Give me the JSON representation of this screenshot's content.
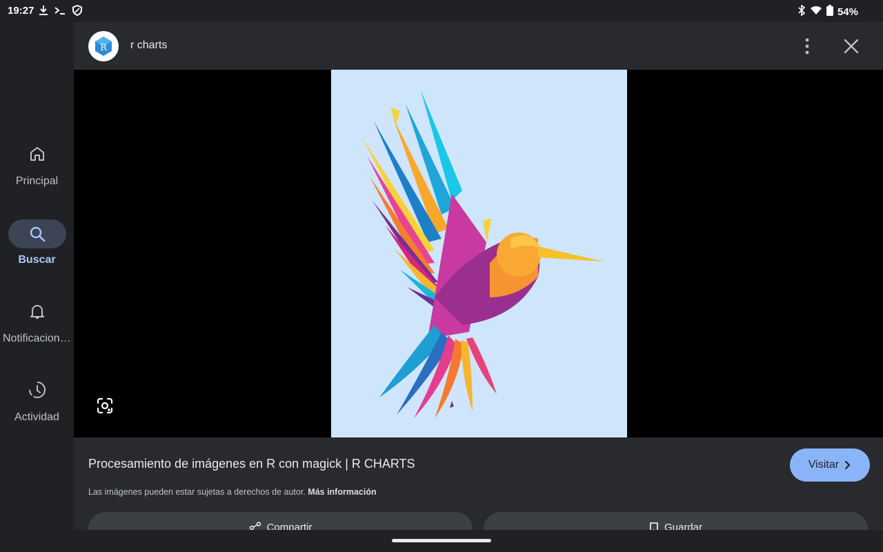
{
  "status_bar": {
    "time": "19:27",
    "battery_percent": "54%",
    "left_icons": [
      "download-icon",
      "terminal-icon",
      "shield-icon"
    ],
    "right_icons": [
      "bluetooth-icon",
      "wifi-icon",
      "battery-icon"
    ]
  },
  "rail": {
    "items": [
      {
        "label": "Principal",
        "icon": "home-icon",
        "active": false
      },
      {
        "label": "Buscar",
        "icon": "search-icon",
        "active": true
      },
      {
        "label": "Notificaciones",
        "icon": "bell-icon",
        "active": false
      },
      {
        "label": "Actividad",
        "icon": "activity-icon",
        "active": false
      }
    ]
  },
  "header": {
    "site_name": "r charts",
    "avatar_letter": "R"
  },
  "viewer": {
    "image_subject": "colorful-hummingbird"
  },
  "result": {
    "title": "Procesamiento de imágenes en R con magick | R CHARTS",
    "copyright_text": "Las imágenes pueden estar sujetas a derechos de autor.",
    "more_info": "Más información",
    "visit_label": "Visitar",
    "share_label": "Compartir",
    "save_label": "Guardar"
  },
  "colors": {
    "accent": "#8ab4f8",
    "active_rail_label": "#a8c7fa",
    "image_background": "#cfe5fb"
  }
}
